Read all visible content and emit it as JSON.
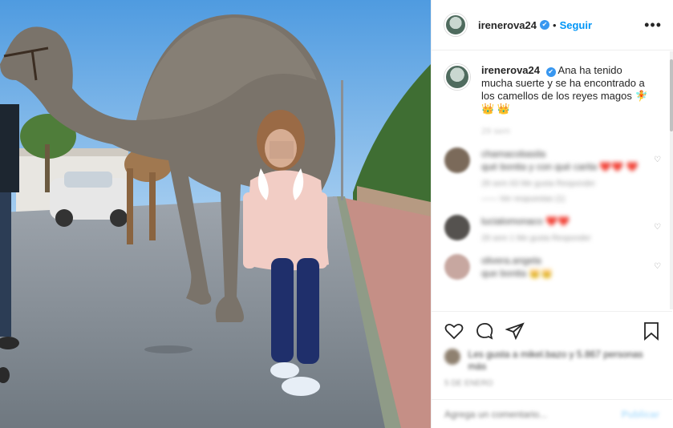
{
  "post": {
    "username": "irenerova24",
    "verified_mark": "✔",
    "separator": "•",
    "follow_label": "Seguir",
    "more_label": "•••"
  },
  "caption": {
    "username": "irenerova24",
    "text": "Ana ha tenido mucha suerte y se ha encontrado a los camellos de los reyes magos 🧚 👑 👑",
    "time_ago": "29 sem"
  },
  "comments": [
    {
      "user": "chamacobasila",
      "text": "qué bonita y con qué carita ❤️❤️ ❤️",
      "meta": "29 sem   63 Me gusta   Responder",
      "replies": "—— Ver respuestas (1)",
      "avatar_color": "#7b6a5a"
    },
    {
      "user": "lucialomonaco",
      "text": "❤️❤️",
      "meta": "29 sem   1 Me gusta   Responder",
      "replies": "",
      "avatar_color": "#55524f"
    },
    {
      "user": "olivera.angela",
      "text": "que bonita 👑👑",
      "meta": "",
      "replies": "",
      "avatar_color": "#c7a7a0"
    }
  ],
  "actions": {
    "like_icon": "heart-icon",
    "comment_icon": "comment-icon",
    "share_icon": "share-icon",
    "save_icon": "bookmark-icon"
  },
  "likes": {
    "text": "Les gusta a mikel.bazo y 5.867 personas más"
  },
  "date": "5 DE ENERO",
  "add_comment": {
    "placeholder": "Agrega un comentario...",
    "publish_label": "Publicar"
  },
  "colors": {
    "accent": "#0095f6",
    "verified": "#3897f0",
    "sky": "#6aaee6"
  }
}
